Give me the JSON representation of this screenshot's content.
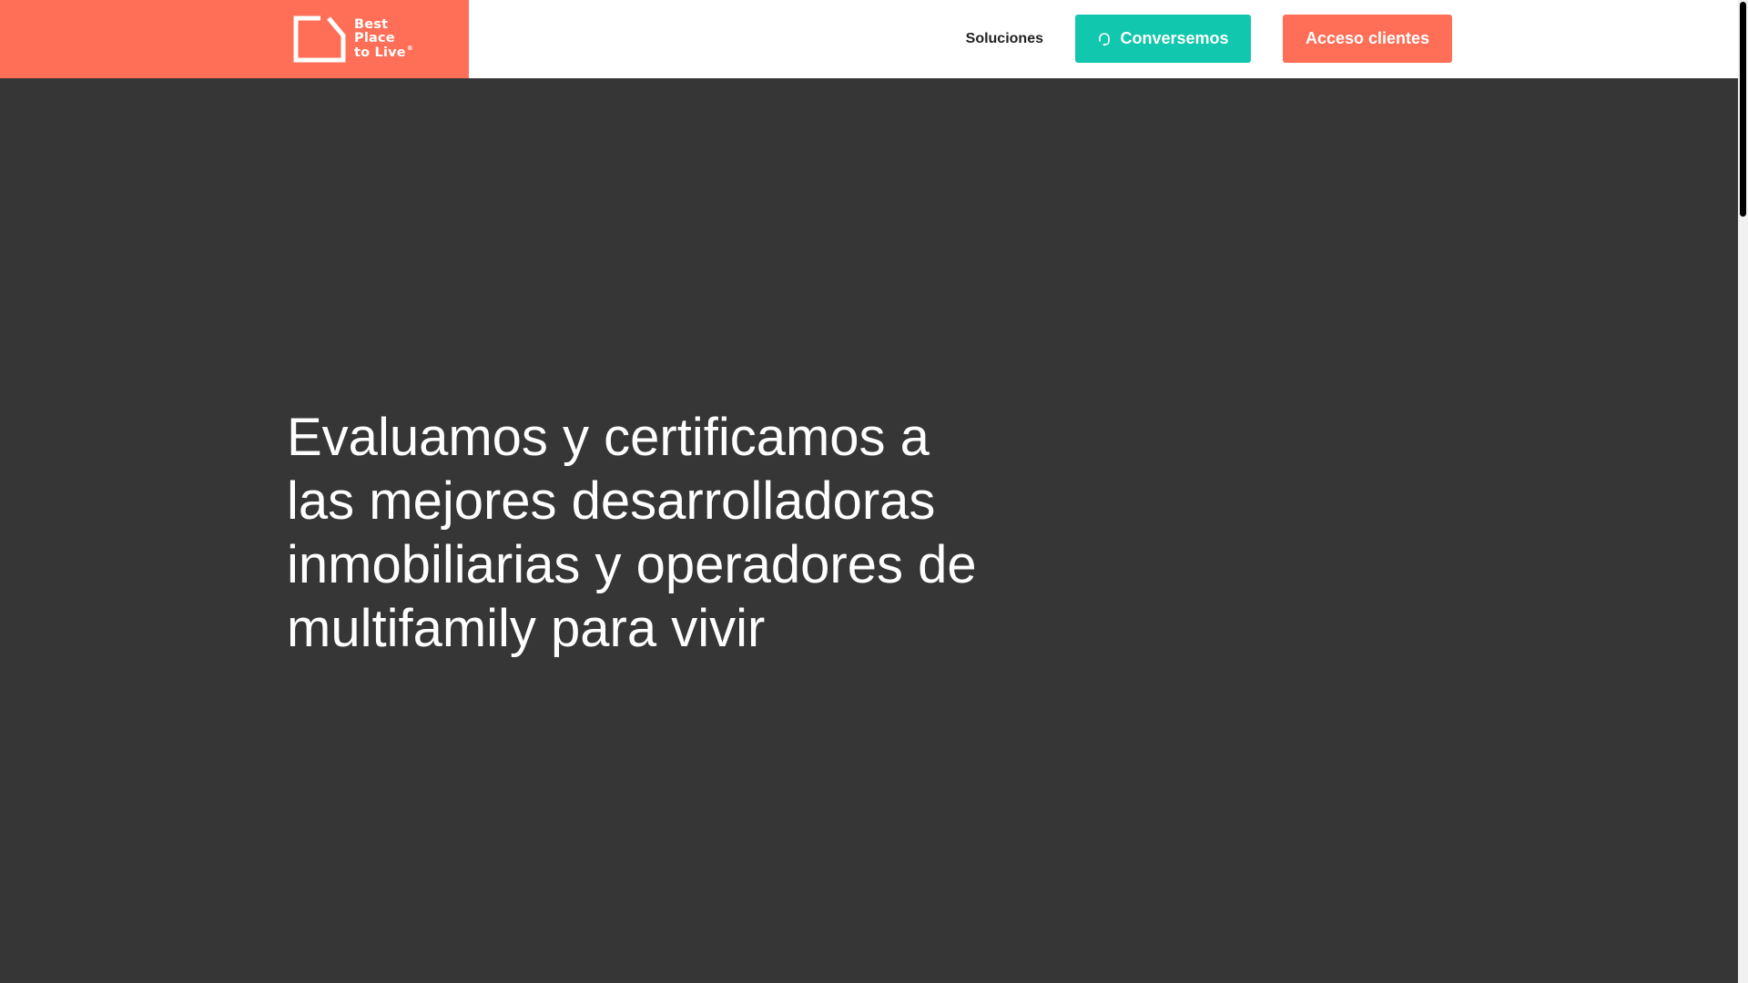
{
  "brand": {
    "line1": "Best",
    "line2": "Place",
    "line3": "to Live",
    "registered": "®",
    "logo_color": "#ff6e57"
  },
  "nav": {
    "solutions_label": "Soluciones",
    "chat_label": "Conversemos",
    "chat_icon": "headset-icon",
    "chat_color": "#11c7ad",
    "access_label": "Acceso clientes",
    "access_color": "#ff6e57"
  },
  "hero": {
    "title": "Evaluamos y certificamos a las mejores desarrolladoras inmobiliarias y operadores de multifamily para vivir",
    "background": "#363636"
  }
}
